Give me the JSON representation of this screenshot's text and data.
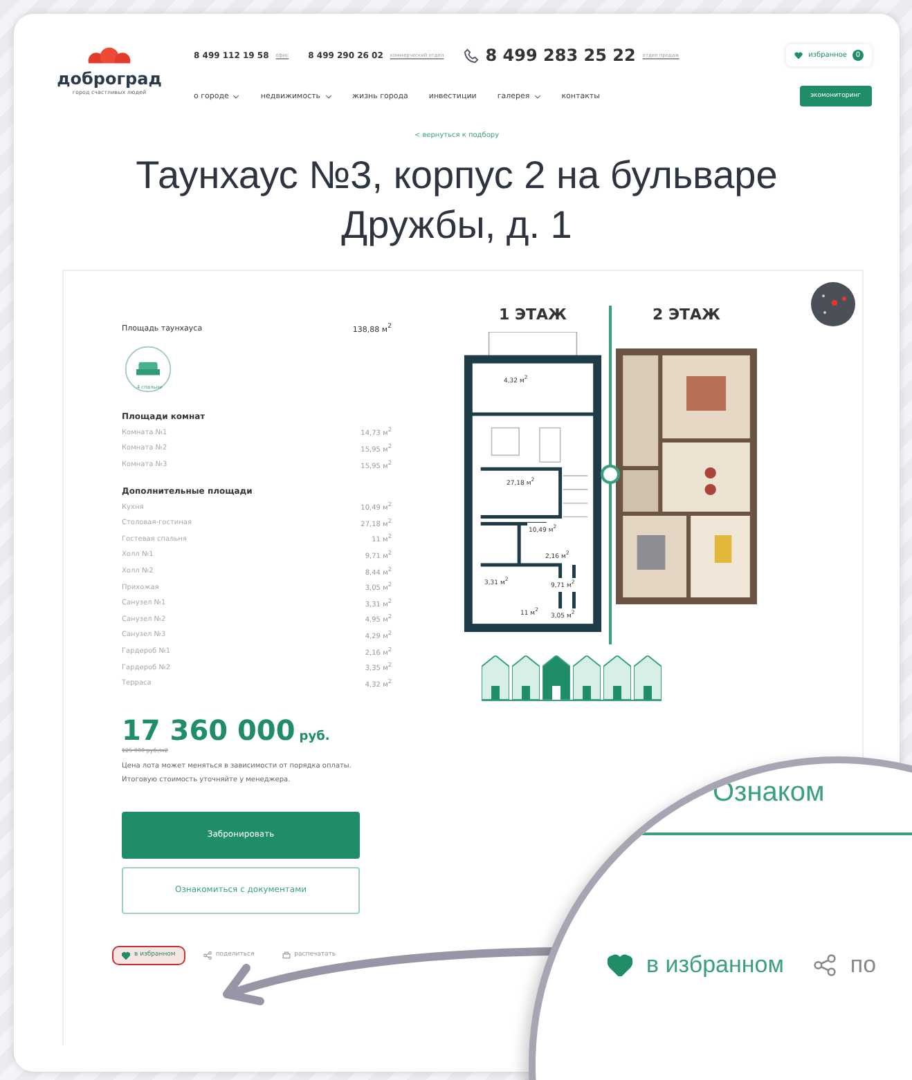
{
  "header": {
    "logo": {
      "name": "доброград",
      "tagline": "город счастливых людей"
    },
    "phones": [
      {
        "number": "8 499 112 19 58",
        "note": "офис"
      },
      {
        "number": "8 499 290 26 02",
        "note": "коммерческий отдел"
      }
    ],
    "main_phone": {
      "number": "8 499 283 25 22",
      "note": "отдел продаж"
    },
    "favorites": {
      "label": "избранное",
      "count": "0"
    },
    "nav": [
      {
        "label": "о городе",
        "dropdown": true
      },
      {
        "label": "недвижимость",
        "dropdown": true
      },
      {
        "label": "жизнь города",
        "dropdown": false
      },
      {
        "label": "инвестиции",
        "dropdown": false
      },
      {
        "label": "галерея",
        "dropdown": true
      },
      {
        "label": "контакты",
        "dropdown": false
      }
    ],
    "cta": "экомониторинг"
  },
  "back_link": "< вернуться к подбору",
  "title": "Таунхаус №3, корпус 2 на бульваре Дружбы, д. 1",
  "total_area": {
    "label": "Площадь таунхауса",
    "value": "138,88 м$^{2}$"
  },
  "bedrooms": "4 спальни",
  "room_groups": [
    {
      "title": "Площади комнат",
      "rows": [
        {
          "name": "Комната №1",
          "value": "14,73 м$^{2}$"
        },
        {
          "name": "Комната №2",
          "value": "15,95 м$^{2}$"
        },
        {
          "name": "Комната №3",
          "value": "15,95 м$^{2}$"
        }
      ]
    },
    {
      "title": "Дополнительные площади",
      "rows": [
        {
          "name": "Кухня",
          "value": "10,49 м$^{2}$"
        },
        {
          "name": "Столовая-гостиная",
          "value": "27,18 м$^{2}$"
        },
        {
          "name": "Гостевая спальня",
          "value": "11 м$^{2}$"
        },
        {
          "name": "Холл №1",
          "value": "9,71 м$^{2}$"
        },
        {
          "name": "Холл №2",
          "value": "8,44 м$^{2}$"
        },
        {
          "name": "Прихожая",
          "value": "3,05 м$^{2}$"
        },
        {
          "name": "Санузел №1",
          "value": "3,31 м$^{2}$"
        },
        {
          "name": "Санузел №2",
          "value": "4,95 м$^{2}$"
        },
        {
          "name": "Санузел №3",
          "value": "4,29 м$^{2}$"
        },
        {
          "name": "Гардероб №1",
          "value": "2,16 м$^{2}$"
        },
        {
          "name": "Гардероб №2",
          "value": "3,35 м$^{2}$"
        },
        {
          "name": "Терраса",
          "value": "4,32 м$^{2}$"
        }
      ]
    }
  ],
  "price": {
    "value": "17 360 000",
    "currency": "руб.",
    "per_meter": "125 000 руб./м2",
    "note": "Цена лота может меняться в зависимости от порядка оплаты. Итоговую стоимость уточняйте у менеджера."
  },
  "buttons": [
    {
      "label": "Забронировать",
      "kind": "primary"
    },
    {
      "label": "Ознакомиться с документами",
      "kind": "outline"
    }
  ],
  "actions": [
    {
      "label": "в избранном",
      "kind": "favorite",
      "selected": true
    },
    {
      "label": "поделиться",
      "kind": "share"
    },
    {
      "label": "распечатать",
      "kind": "print"
    }
  ],
  "floors": [
    {
      "label": "1 ЭТАЖ",
      "kind": "plan"
    },
    {
      "label": "2 ЭТАЖ",
      "kind": "picture"
    }
  ],
  "plan_labels": [
    "4,32 м$^{2}$",
    "27,18 м$^{2}$",
    "10,49 м$^{2}$",
    "2,16 м$^{2}$",
    "3,31 м$^{2}$",
    "9,71 м$^{2}$",
    "11 м$^{2}$",
    "3,05 м$^{2}$"
  ],
  "houses": [
    {
      "selected": false
    },
    {
      "selected": false
    },
    {
      "selected": true
    },
    {
      "selected": false
    },
    {
      "selected": false
    },
    {
      "selected": false
    }
  ],
  "magnifier": {
    "button": "Ознаком",
    "favorite": {
      "label": "в избранном",
      "selected": true
    },
    "share": "по"
  }
}
